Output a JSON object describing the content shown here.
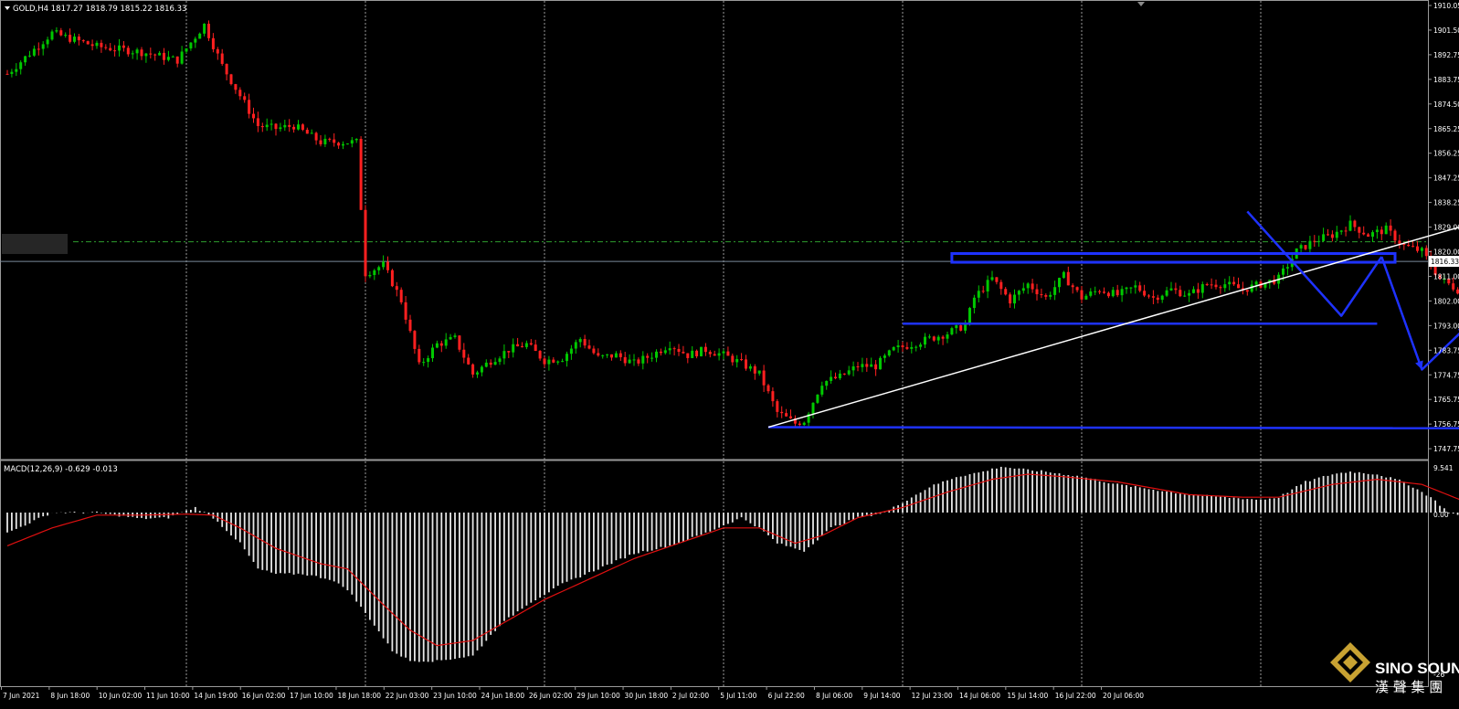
{
  "header": {
    "symbol_caption": "GOLD,H4  1817.27 1818.79 1815.22 1816.33",
    "macd_caption": "MACD(12,26,9) -0.629 -0.013"
  },
  "price_axis": {
    "ticks": [
      "1910.05",
      "1901.50",
      "1892.75",
      "1883.75",
      "1874.50",
      "1865.25",
      "1856.25",
      "1847.25",
      "1838.25",
      "1829.00",
      "1820.00",
      "1811.00",
      "1802.00",
      "1793.00",
      "1783.75",
      "1774.75",
      "1765.75",
      "1756.75",
      "1747.75"
    ],
    "current_price_label": "1816.33"
  },
  "macd_axis": {
    "ticks": [
      "9.541",
      "0.00",
      "-26"
    ]
  },
  "time_axis": {
    "labels": [
      "7 Jun 2021",
      "8 Jun 18:00",
      "10 Jun 02:00",
      "11 Jun 10:00",
      "14 Jun 19:00",
      "16 Jun 02:00",
      "17 Jun 10:00",
      "18 Jun 18:00",
      "22 Jun 03:00",
      "23 Jun 10:00",
      "24 Jun 18:00",
      "26 Jun 02:00",
      "29 Jun 10:00",
      "30 Jun 18:00",
      "2 Jul 02:00",
      "5 Jul 11:00",
      "6 Jul 22:00",
      "8 Jul 06:00",
      "9 Jul 14:00",
      "12 Jul 23:00",
      "14 Jul 06:00",
      "15 Jul 14:00",
      "16 Jul 22:00",
      "20 Jul 06:00"
    ]
  },
  "logo": {
    "name": "SINO SOUND",
    "subtitle": "漢 聲 集 團"
  },
  "colors": {
    "background": "#000000",
    "bull_candle": "#00c800",
    "bear_candle": "#ff2020",
    "grid": "#9a9a9a",
    "drawing_blue": "#1e32ff",
    "trendline": "#ffffff",
    "signal_line": "#e01010",
    "macd_histogram": "#e6e6e6",
    "dashed_level": "#2e9e2e"
  },
  "chart_data": {
    "type": "candlestick",
    "symbol": "GOLD",
    "timeframe": "H4",
    "last_bar": {
      "open": 1817.27,
      "high": 1818.79,
      "low": 1815.22,
      "close": 1816.33
    },
    "ylim": [
      1747.75,
      1910.05
    ],
    "grid": true,
    "price_keypoints": [
      [
        0,
        1885
      ],
      [
        10,
        1900
      ],
      [
        20,
        1895
      ],
      [
        30,
        1893
      ],
      [
        38,
        1890
      ],
      [
        44,
        1903
      ],
      [
        48,
        1888
      ],
      [
        52,
        1877
      ],
      [
        56,
        1866
      ],
      [
        60,
        1865
      ],
      [
        64,
        1866
      ],
      [
        70,
        1860
      ],
      [
        76,
        1860
      ],
      [
        78,
        1860
      ],
      [
        80,
        1812
      ],
      [
        84,
        1815
      ],
      [
        88,
        1802
      ],
      [
        92,
        1778
      ],
      [
        96,
        1786
      ],
      [
        100,
        1788
      ],
      [
        104,
        1775
      ],
      [
        108,
        1780
      ],
      [
        112,
        1784
      ],
      [
        116,
        1786
      ],
      [
        120,
        1780
      ],
      [
        124,
        1781
      ],
      [
        128,
        1788
      ],
      [
        132,
        1781
      ],
      [
        136,
        1782
      ],
      [
        140,
        1779
      ],
      [
        144,
        1782
      ],
      [
        148,
        1786
      ],
      [
        152,
        1782
      ],
      [
        156,
        1784
      ],
      [
        160,
        1782
      ],
      [
        164,
        1779
      ],
      [
        168,
        1775
      ],
      [
        172,
        1761
      ],
      [
        176,
        1757
      ],
      [
        178,
        1758
      ],
      [
        182,
        1772
      ],
      [
        186,
        1774
      ],
      [
        190,
        1778
      ],
      [
        194,
        1778
      ],
      [
        198,
        1784
      ],
      [
        202,
        1786
      ],
      [
        206,
        1788
      ],
      [
        210,
        1790
      ],
      [
        214,
        1793
      ],
      [
        216,
        1803
      ],
      [
        220,
        1810
      ],
      [
        224,
        1802
      ],
      [
        228,
        1808
      ],
      [
        232,
        1803
      ],
      [
        236,
        1811
      ],
      [
        240,
        1803
      ],
      [
        244,
        1806
      ],
      [
        248,
        1804
      ],
      [
        252,
        1807
      ],
      [
        256,
        1803
      ],
      [
        260,
        1806
      ],
      [
        264,
        1804
      ],
      [
        268,
        1808
      ],
      [
        272,
        1808
      ],
      [
        276,
        1806
      ],
      [
        280,
        1808
      ],
      [
        284,
        1810
      ],
      [
        288,
        1820
      ],
      [
        292,
        1824
      ],
      [
        296,
        1826
      ],
      [
        300,
        1830
      ],
      [
        304,
        1826
      ],
      [
        308,
        1828
      ],
      [
        312,
        1822
      ],
      [
        316,
        1820
      ],
      [
        320,
        1810
      ],
      [
        324,
        1806
      ],
      [
        328,
        1803
      ],
      [
        332,
        1807
      ],
      [
        336,
        1812
      ],
      [
        338,
        1816.33
      ]
    ],
    "macd_range": [
      -26,
      9.541
    ],
    "macd_keypoints": [
      [
        0,
        -4
      ],
      [
        10,
        0
      ],
      [
        20,
        0
      ],
      [
        30,
        -1.2
      ],
      [
        36,
        -1
      ],
      [
        42,
        1
      ],
      [
        46,
        -1
      ],
      [
        52,
        -6
      ],
      [
        56,
        -11
      ],
      [
        60,
        -12
      ],
      [
        66,
        -12
      ],
      [
        72,
        -13
      ],
      [
        76,
        -15
      ],
      [
        82,
        -22
      ],
      [
        86,
        -27
      ],
      [
        90,
        -29
      ],
      [
        96,
        -29
      ],
      [
        104,
        -28
      ],
      [
        110,
        -22
      ],
      [
        116,
        -18
      ],
      [
        124,
        -14
      ],
      [
        132,
        -11
      ],
      [
        140,
        -8
      ],
      [
        148,
        -6.5
      ],
      [
        156,
        -4
      ],
      [
        164,
        -1
      ],
      [
        168,
        -3
      ],
      [
        172,
        -6
      ],
      [
        176,
        -7
      ],
      [
        178,
        -7.5
      ],
      [
        184,
        -3
      ],
      [
        190,
        -1
      ],
      [
        196,
        0
      ],
      [
        200,
        2
      ],
      [
        206,
        5
      ],
      [
        212,
        7
      ],
      [
        218,
        8
      ],
      [
        222,
        9
      ],
      [
        226,
        8.5
      ],
      [
        232,
        8
      ],
      [
        240,
        7
      ],
      [
        248,
        5.5
      ],
      [
        256,
        4.5
      ],
      [
        264,
        3.5
      ],
      [
        272,
        3
      ],
      [
        280,
        2.5
      ],
      [
        284,
        3
      ],
      [
        290,
        6
      ],
      [
        296,
        7.5
      ],
      [
        300,
        8
      ],
      [
        306,
        7.5
      ],
      [
        312,
        6
      ],
      [
        318,
        3
      ],
      [
        322,
        0
      ],
      [
        326,
        -1
      ],
      [
        330,
        -2
      ],
      [
        334,
        -1.5
      ],
      [
        338,
        -0.629
      ]
    ],
    "signal_keypoints": [
      [
        0,
        -6.5
      ],
      [
        10,
        -3
      ],
      [
        20,
        -0.5
      ],
      [
        30,
        -0.5
      ],
      [
        40,
        -0.3
      ],
      [
        46,
        -0.5
      ],
      [
        52,
        -3
      ],
      [
        60,
        -7
      ],
      [
        70,
        -10
      ],
      [
        76,
        -11
      ],
      [
        84,
        -18
      ],
      [
        90,
        -23
      ],
      [
        96,
        -26
      ],
      [
        104,
        -25
      ],
      [
        110,
        -22
      ],
      [
        120,
        -17
      ],
      [
        130,
        -13
      ],
      [
        140,
        -9
      ],
      [
        150,
        -6
      ],
      [
        160,
        -3
      ],
      [
        168,
        -3
      ],
      [
        176,
        -6
      ],
      [
        182,
        -4.5
      ],
      [
        190,
        -1
      ],
      [
        200,
        1
      ],
      [
        210,
        4
      ],
      [
        220,
        6.5
      ],
      [
        228,
        7.5
      ],
      [
        236,
        7
      ],
      [
        248,
        6
      ],
      [
        264,
        3.5
      ],
      [
        276,
        3
      ],
      [
        284,
        3
      ],
      [
        296,
        5.5
      ],
      [
        306,
        6.5
      ],
      [
        316,
        5.5
      ],
      [
        326,
        2
      ],
      [
        332,
        0.5
      ],
      [
        338,
        -0.013
      ]
    ],
    "levels": [
      {
        "kind": "dashed",
        "price": 1823.5
      },
      {
        "kind": "current",
        "price": 1816.33
      }
    ],
    "drawings": [
      {
        "kind": "zone",
        "from": [
          211,
          1819.2
        ],
        "to": [
          310,
          1817.0
        ]
      },
      {
        "kind": "hline",
        "from": [
          200,
          1793.5
        ],
        "to": [
          306,
          1793.5
        ]
      },
      {
        "kind": "hline-arrow",
        "from": [
          170,
          1755.6
        ],
        "to": [
          333,
          1755.2
        ]
      },
      {
        "kind": "trendline",
        "from": [
          170,
          1755.6
        ],
        "to": [
          347,
          1839.6
        ]
      },
      {
        "kind": "path",
        "points": [
          [
            277,
            1834.6
          ],
          [
            298,
            1796.4
          ],
          [
            307,
            1818.0
          ]
        ]
      },
      {
        "kind": "path-arrow",
        "points": [
          [
            307,
            1818.0
          ],
          [
            316,
            1776.7
          ],
          [
            326,
            1792.4
          ],
          [
            334,
            1761.0
          ]
        ]
      }
    ]
  }
}
